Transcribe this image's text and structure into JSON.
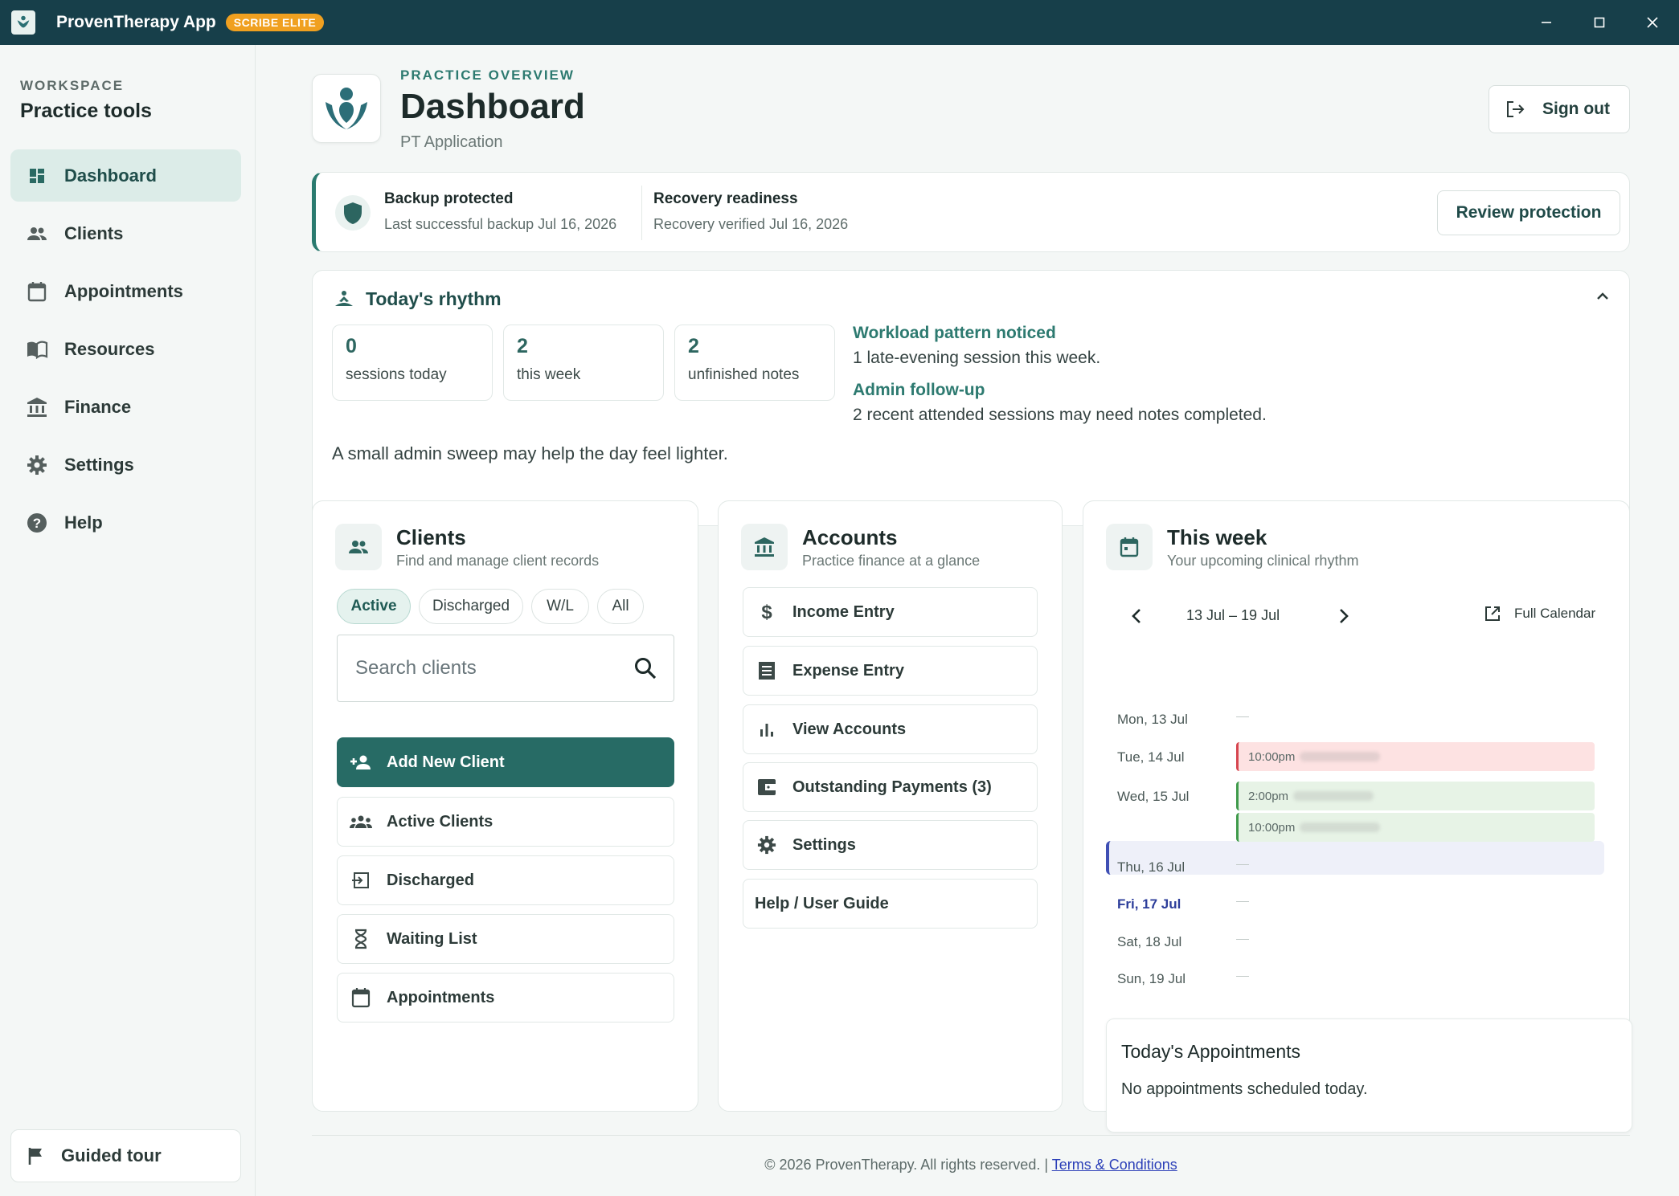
{
  "titlebar": {
    "app_name": "ProvenTherapy App",
    "badge": "SCRIBE ELITE",
    "controls": [
      "minimize-icon",
      "maximize-icon",
      "close-icon"
    ]
  },
  "sidebar": {
    "kicker": "WORKSPACE",
    "title": "Practice tools",
    "items": [
      {
        "label": "Dashboard",
        "icon": "dashboard-icon",
        "active": true
      },
      {
        "label": "Clients",
        "icon": "people-icon"
      },
      {
        "label": "Appointments",
        "icon": "calendar-icon"
      },
      {
        "label": "Resources",
        "icon": "book-icon"
      },
      {
        "label": "Finance",
        "icon": "bank-icon"
      },
      {
        "label": "Settings",
        "icon": "gear-icon"
      },
      {
        "label": "Help",
        "icon": "help-icon"
      }
    ],
    "tour_label": "Guided tour"
  },
  "header": {
    "kicker": "PRACTICE OVERVIEW",
    "title": "Dashboard",
    "subtitle": "PT Application",
    "signout_label": "Sign out"
  },
  "backup": {
    "title": "Backup protected",
    "subtitle": "Last successful backup Jul 16, 2026",
    "recovery_title": "Recovery readiness",
    "recovery_subtitle": "Recovery verified Jul 16, 2026",
    "review_label": "Review protection"
  },
  "rhythm": {
    "title": "Today's rhythm",
    "stats": [
      {
        "num": "0",
        "label": "sessions today"
      },
      {
        "num": "2",
        "label": "this week"
      },
      {
        "num": "2",
        "label": "unfinished notes"
      }
    ],
    "insights": [
      {
        "heading": "Workload pattern noticed",
        "text": "1 late-evening session this week."
      },
      {
        "heading": "Admin follow-up",
        "text": "2 recent attended sessions may need notes completed."
      }
    ],
    "note": "A small admin sweep may help the day feel lighter."
  },
  "clients": {
    "title": "Clients",
    "subtitle": "Find and manage client records",
    "chips": [
      "Active",
      "Discharged",
      "W/L",
      "All"
    ],
    "search_placeholder": "Search clients",
    "actions": [
      "Add New Client",
      "Active Clients",
      "Discharged",
      "Waiting List",
      "Appointments"
    ]
  },
  "accounts": {
    "title": "Accounts",
    "subtitle": "Practice finance at a glance",
    "actions": [
      "Income Entry",
      "Expense Entry",
      "View Accounts",
      "Outstanding Payments (3)",
      "Settings",
      "Help / User Guide"
    ]
  },
  "week": {
    "title": "This week",
    "subtitle": "Your upcoming clinical rhythm",
    "range": "13 Jul – 19 Jul",
    "full_calendar": "Full Calendar",
    "days": [
      "Mon, 13 Jul",
      "Tue, 14 Jul",
      "Wed, 15 Jul",
      "Thu, 16 Jul",
      "Fri, 17 Jul",
      "Sat, 18 Jul",
      "Sun, 19 Jul"
    ],
    "appointments": [
      {
        "time": "10:00pm",
        "status": "red"
      },
      {
        "time": "2:00pm",
        "status": "green"
      },
      {
        "time": "10:00pm",
        "status": "green"
      }
    ],
    "today_title": "Today's Appointments",
    "today_empty": "No appointments scheduled today."
  },
  "footer": {
    "copyright": "© 2026 ProvenTherapy. All rights reserved. |",
    "terms": "Terms & Conditions"
  }
}
